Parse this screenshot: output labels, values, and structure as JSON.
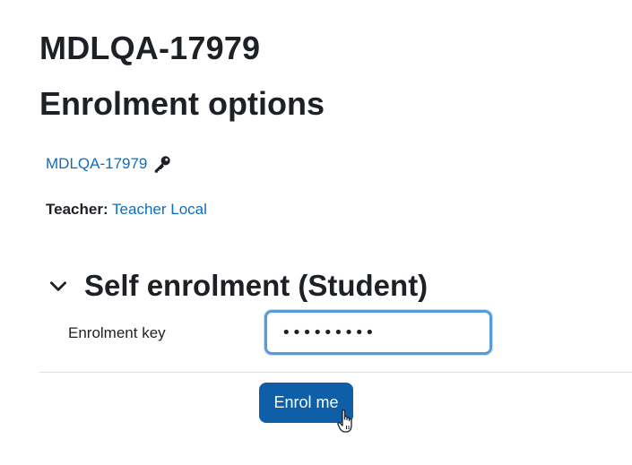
{
  "course": {
    "title": "MDLQA-17979",
    "link_label": "MDLQA-17979",
    "key_icon": "key-icon"
  },
  "page": {
    "heading": "Enrolment options"
  },
  "teacher": {
    "label": "Teacher:",
    "name": "Teacher Local"
  },
  "self_enrolment": {
    "section_title": "Self enrolment (Student)",
    "expanded": true,
    "toggle_icon": "chevron-down-icon",
    "key_label": "Enrolment key",
    "key_value": "•••••••••",
    "submit_label": "Enrol me"
  },
  "colors": {
    "link": "#0f6cbf",
    "button": "#0f5ea8",
    "focus_ring": "#5b9bd5"
  }
}
